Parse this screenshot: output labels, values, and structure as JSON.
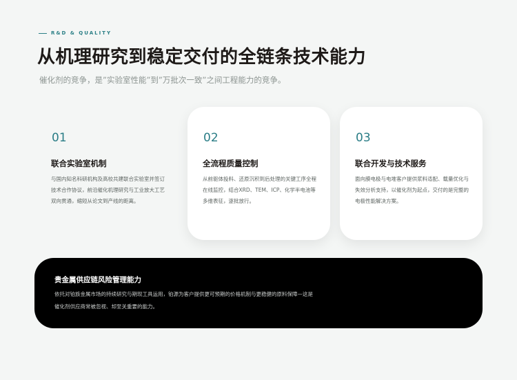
{
  "header": {
    "eyebrow": "R&D & QUALITY",
    "title": "从机理研究到稳定交付的全链条技术能力",
    "subtitle": "催化剂的竞争，是”实验室性能”到”万批次一致”之间工程能力的竞争。"
  },
  "cards": [
    {
      "number": "01",
      "title": "联合实验室机制",
      "body": "与国内知名科研机构及高校共建联合实验室并签订技术合作协议，前沿催化机理研究与工业放大工艺双向贯通，缩短从论文到产线的距离。"
    },
    {
      "number": "02",
      "title": "全流程质量控制",
      "body": "从前驱体投料、还原沉积到后处理的关键工序全程在线监控，结合XRD、TEM、ICP、化学半电池等多维表征，逐批放行。"
    },
    {
      "number": "03",
      "title": "联合开发与技术服务",
      "body": "面向膜电极与电堆客户提供浆料适配、载量优化与失效分析支持，以催化剂为起点，交付的是完整的电极性能解决方案。"
    }
  ],
  "bottom": {
    "title": "贵金属供应链风险管理能力",
    "body": "依托对铂族金属市场的持续研究与期现工具运用，铂源为客户提供更可预期的价格机制与更稳健的原料保障—这是催化剂供应商常被忽视、却至关重要的能力。"
  },
  "colors": {
    "accent": "#2b7f86",
    "background": "#f4f6f5",
    "dark_panel": "#000000"
  }
}
